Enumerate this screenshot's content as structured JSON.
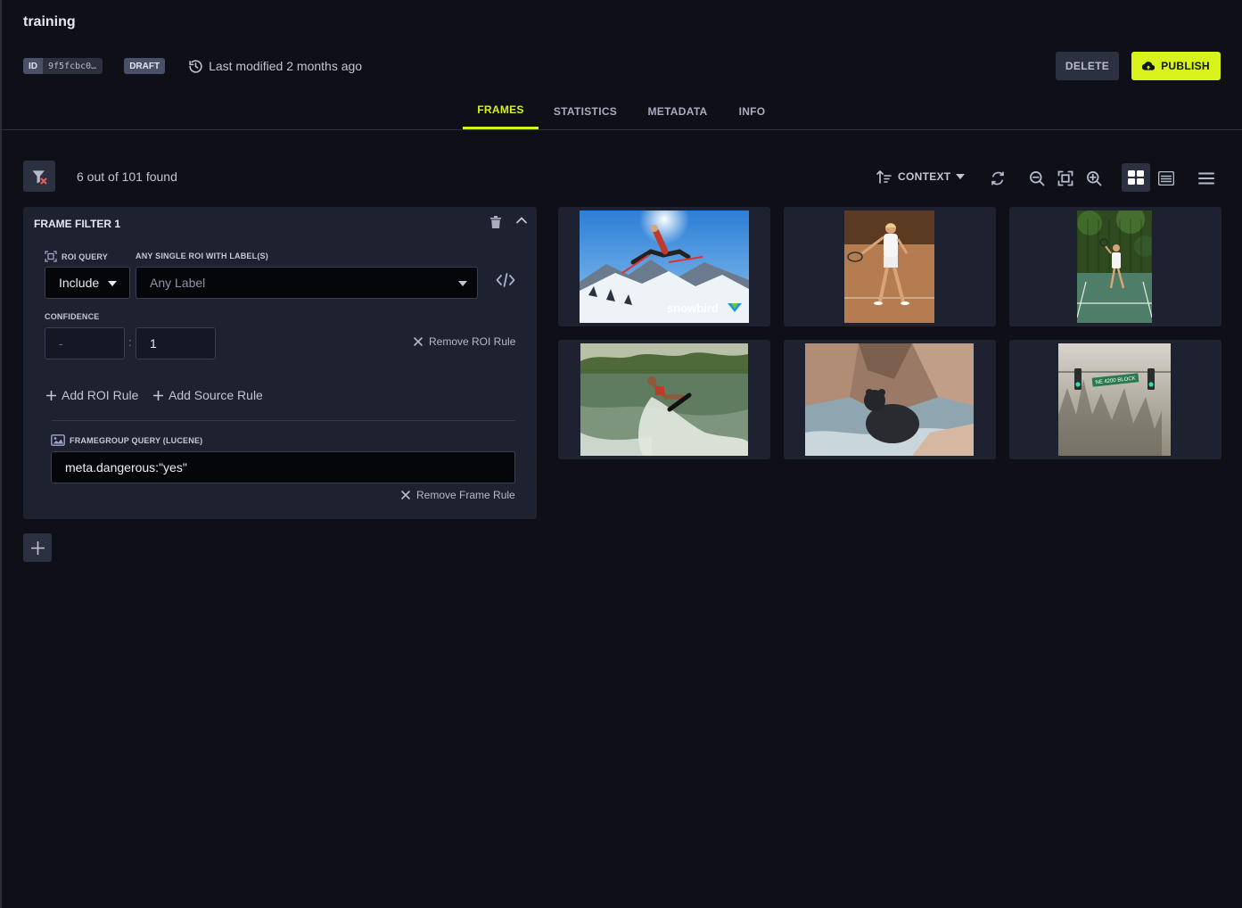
{
  "header": {
    "title": "training",
    "id_label": "ID",
    "id_value": "9f5fcbc0…",
    "status": "DRAFT",
    "last_modified": "Last modified 2 months ago",
    "delete_label": "DELETE",
    "publish_label": "PUBLISH"
  },
  "tabs": [
    {
      "label": "FRAMES",
      "active": true
    },
    {
      "label": "STATISTICS",
      "active": false
    },
    {
      "label": "METADATA",
      "active": false
    },
    {
      "label": "INFO",
      "active": false
    }
  ],
  "toolbar": {
    "found_text": "6 out of 101 found",
    "sort_label": "CONTEXT"
  },
  "filter": {
    "title": "FRAME FILTER 1",
    "roi_query_label": "ROI QUERY",
    "labels_label": "ANY SINGLE ROI WITH LABEL(S)",
    "include_value": "Include",
    "label_placeholder": "Any Label",
    "confidence_label": "CONFIDENCE",
    "confidence_min": "-",
    "confidence_sep": ":",
    "confidence_max": "1",
    "remove_roi": "Remove ROI Rule",
    "add_roi": "Add ROI Rule",
    "add_source": "Add Source Rule",
    "framegroup_label": "FRAMEGROUP QUERY (LUCENE)",
    "lucene_value": "meta.dangerous:\"yes\"",
    "remove_frame": "Remove Frame Rule"
  },
  "frames": [
    {
      "subject": "skier-jump",
      "watermark": "snowbird"
    },
    {
      "subject": "tennis-player-clay"
    },
    {
      "subject": "tennis-player-court"
    },
    {
      "subject": "wakeboarder"
    },
    {
      "subject": "bear-in-water"
    },
    {
      "subject": "traffic-lights-fog",
      "sign": "NE 4200 BLOCK"
    }
  ],
  "colors": {
    "accent": "#d7f31a",
    "background": "#0e0f17",
    "panel": "#1e2130"
  }
}
